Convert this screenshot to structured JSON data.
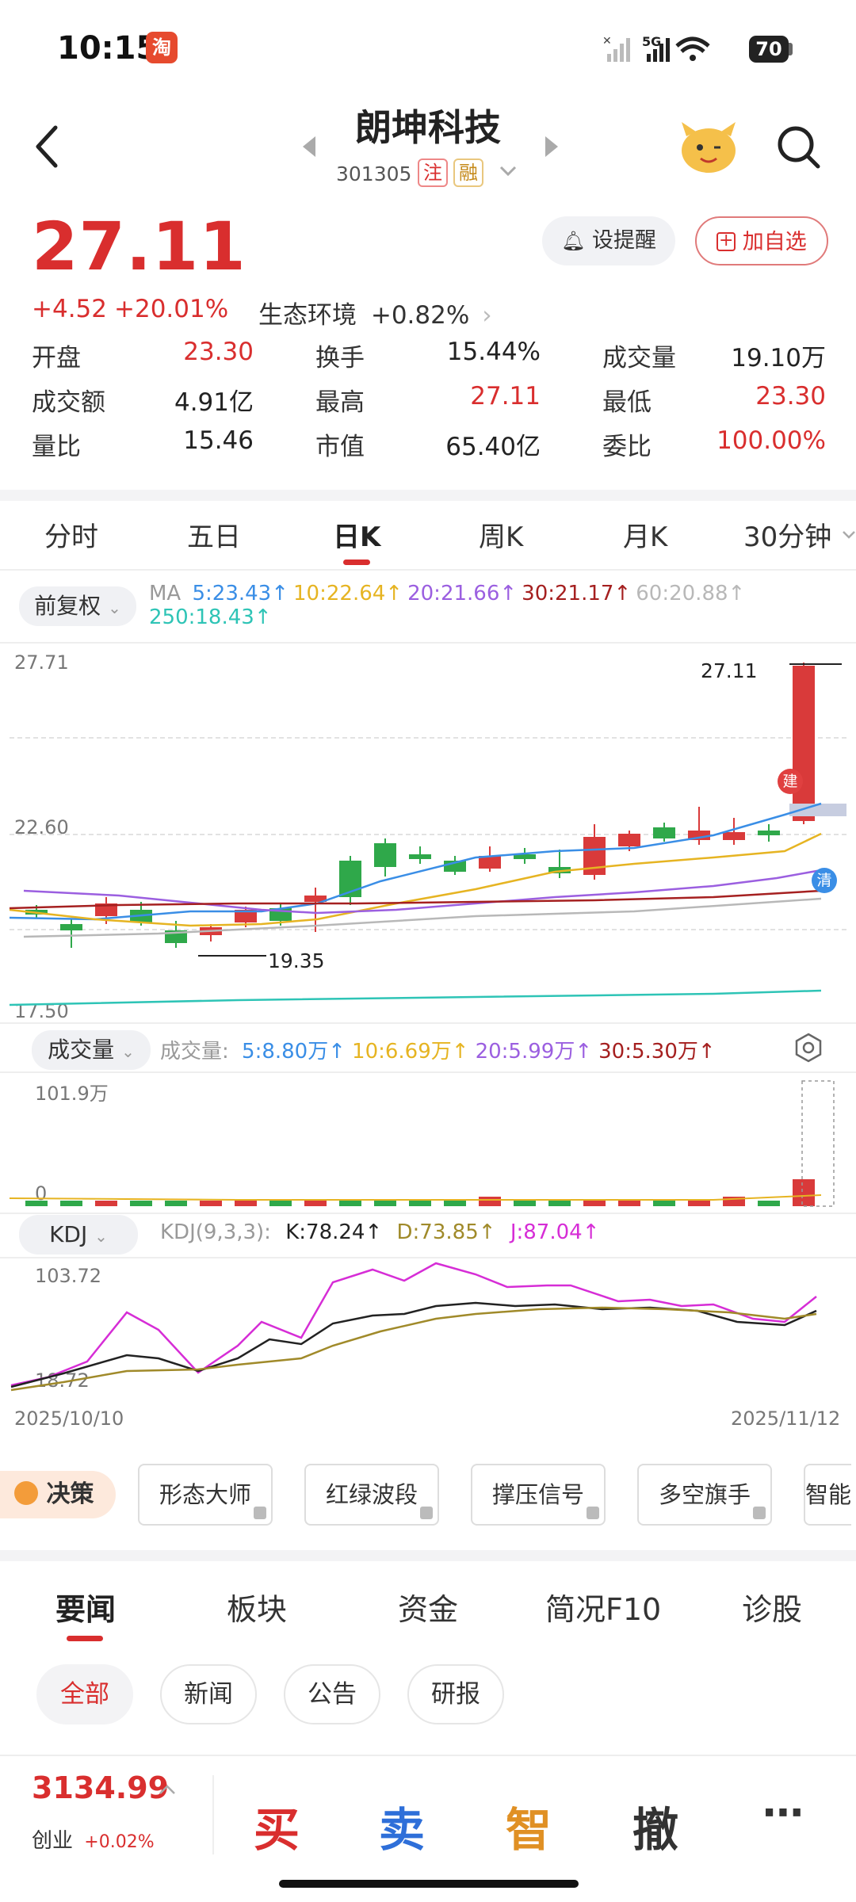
{
  "status": {
    "time": "10:15",
    "app_badge": "淘",
    "network": "5G",
    "battery": "70"
  },
  "header": {
    "title": "朗坤科技",
    "code": "301305",
    "tag1": "注",
    "tag2": "融"
  },
  "quote": {
    "price": "27.11",
    "change": "+4.52",
    "change_pct": "+20.01%",
    "sector_name": "生态环境",
    "sector_chg": "+0.82%",
    "alert_label": "设提醒",
    "watch_label": "加自选"
  },
  "stats": [
    {
      "label": "开盘",
      "value": "23.30",
      "color": "#d92e2e"
    },
    {
      "label": "换手",
      "value": "15.44%",
      "color": "#222222"
    },
    {
      "label": "成交量",
      "value": "19.10万",
      "color": "#222222"
    },
    {
      "label": "成交额",
      "value": "4.91亿",
      "color": "#222222"
    },
    {
      "label": "最高",
      "value": "27.11",
      "color": "#d92e2e"
    },
    {
      "label": "最低",
      "value": "23.30",
      "color": "#d92e2e"
    },
    {
      "label": "量比",
      "value": "15.46",
      "color": "#222222"
    },
    {
      "label": "市值",
      "value": "65.40亿",
      "color": "#222222"
    },
    {
      "label": "委比",
      "value": "100.00%",
      "color": "#d92e2e"
    }
  ],
  "chart_tabs": [
    "分时",
    "五日",
    "日K",
    "周K",
    "月K",
    "30分钟"
  ],
  "active_tab": "日K",
  "kline": {
    "adjust_label": "前复权",
    "ma_prefix": "MA",
    "ma": [
      {
        "label": "5:23.43",
        "arrow": "↑",
        "color": "#3a8ee6"
      },
      {
        "label": "10:22.64",
        "arrow": "↑",
        "color": "#e6b422"
      },
      {
        "label": "20:21.66",
        "arrow": "↑",
        "color": "#9b5fe0"
      },
      {
        "label": "30:21.17",
        "arrow": "↑",
        "color": "#a52020"
      },
      {
        "label": "60:20.88",
        "arrow": "↑",
        "color": "#b8b8b8"
      },
      {
        "label": "250:18.43",
        "arrow": "↑",
        "color": "#2ec4b6"
      }
    ],
    "y_top": "27.71",
    "y_mid": "22.60",
    "y_bottom": "17.50",
    "high_label": "27.11",
    "low_label": "19.35",
    "build_badge": "建",
    "clear_badge": "清"
  },
  "volume": {
    "label": "成交量",
    "prefix": "成交量:",
    "ma": [
      {
        "label": "5:8.80万",
        "arrow": "↑",
        "color": "#3a8ee6"
      },
      {
        "label": "10:6.69万",
        "arrow": "↑",
        "color": "#e6b422"
      },
      {
        "label": "20:5.99万",
        "arrow": "↑",
        "color": "#9b5fe0"
      },
      {
        "label": "30:5.30万",
        "arrow": "↑",
        "color": "#a52020"
      }
    ],
    "y_top": "101.9万",
    "y_zero": "0"
  },
  "kdj": {
    "label": "KDJ",
    "params": "KDJ(9,3,3):",
    "k": "K:78.24",
    "d": "D:73.85",
    "j": "J:87.04",
    "arrow": "↑",
    "y_top": "103.72",
    "y_bottom": "18.72",
    "date_start": "2025/10/10",
    "date_end": "2025/11/12"
  },
  "tools": {
    "decision": "决策",
    "items": [
      "形态大师",
      "红绿波段",
      "撑压信号",
      "多空旗手",
      "智能"
    ]
  },
  "news_tabs": [
    "要闻",
    "板块",
    "资金",
    "简况F10",
    "诊股"
  ],
  "news_chips": [
    "全部",
    "新闻",
    "公告",
    "研报"
  ],
  "index": {
    "value": "3134.99",
    "name": "创业",
    "chg": "+0.02%"
  },
  "actions": {
    "buy": "买",
    "sell": "卖",
    "smart": "智",
    "cancel": "撤",
    "more": "⋯"
  }
}
